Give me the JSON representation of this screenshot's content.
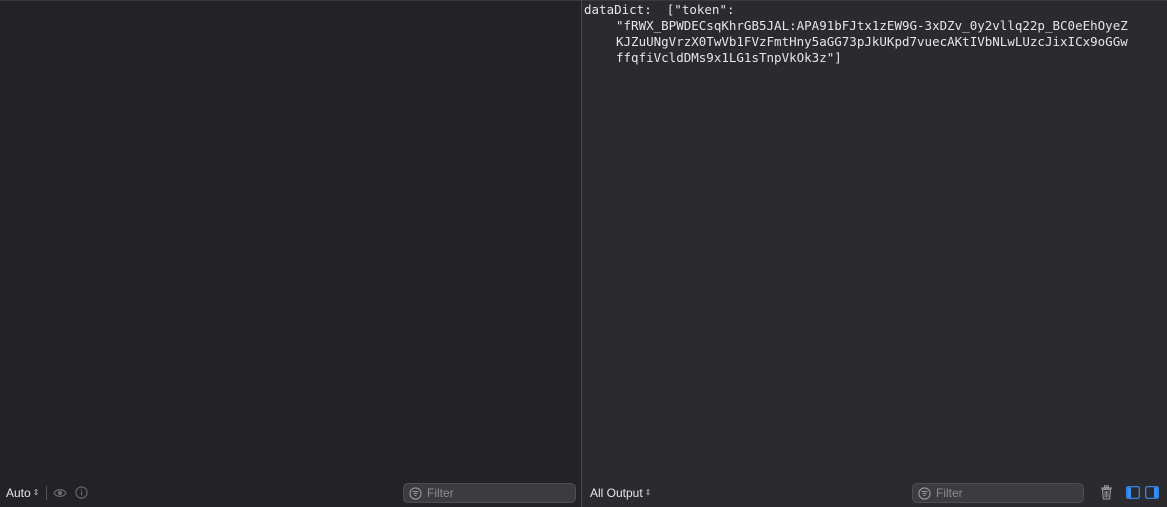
{
  "left_pane": {
    "mode_select": {
      "value": "Auto",
      "arrow": "⇕"
    },
    "filter": {
      "placeholder": "Filter"
    },
    "icons": [
      "eye-icon",
      "info-icon",
      "filter-icon"
    ]
  },
  "console": {
    "lines": [
      "dataDict:  [\"token\":",
      "\"fRWX_BPWDECsqKhrGB5JAL:APA91bFJtx1zEW9G-3xDZv_0y2vllq22p_BC0eEhOyeZ",
      "KJZuUNgVrzX0TwVb1FVzFmtHny5aGG73pJkUKpd7vuecAKtIVbNLwLUzcJixICx9oGGw",
      "ffqfiVcldDMs9x1LG1sTnpVkOk3z\"]"
    ]
  },
  "right_pane": {
    "output_select": {
      "value": "All Output",
      "arrow": "⇕"
    },
    "filter": {
      "placeholder": "Filter"
    },
    "icons": [
      "trash-icon",
      "panel-left-icon",
      "panel-right-icon",
      "filter-icon"
    ]
  },
  "colors": {
    "background_left": "#232226",
    "background_right": "#2b2a2f",
    "text": "#e6e6e6",
    "accent": "#3a8ef6"
  }
}
